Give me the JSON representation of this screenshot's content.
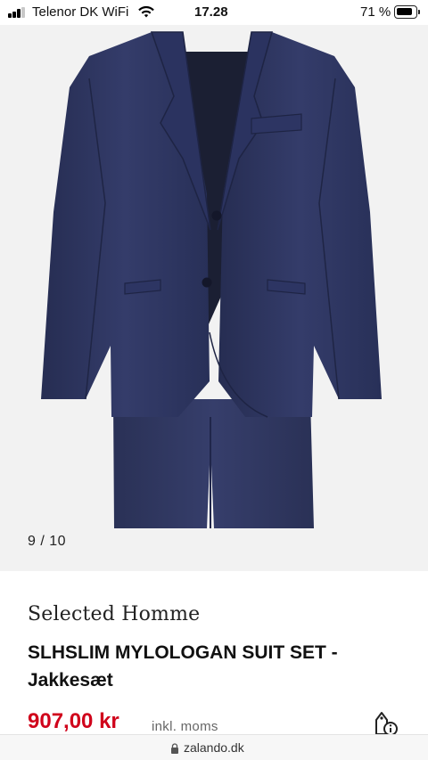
{
  "status_bar": {
    "carrier": "Telenor DK WiFi",
    "time": "17.28",
    "battery": "71 %",
    "icons": [
      "signal-icon",
      "wifi-icon",
      "battery-icon"
    ]
  },
  "gallery": {
    "counter": "9 / 10",
    "image_subject": "navy blue slim suit set on white background",
    "colors": {
      "background": "#f2f2f2",
      "suit": "#2e3660"
    }
  },
  "product": {
    "brand": "Selected Homme",
    "title": "SLHSLIM MYLOLOGAN SUIT SET - Jakkesæt",
    "price": "907,00 kr",
    "tax_note": "inkl. moms",
    "price_color": "#d0021b",
    "tag_icon": "price-tag-info-icon"
  },
  "browser": {
    "url": "zalando.dk",
    "lock_icon": "lock-icon"
  }
}
